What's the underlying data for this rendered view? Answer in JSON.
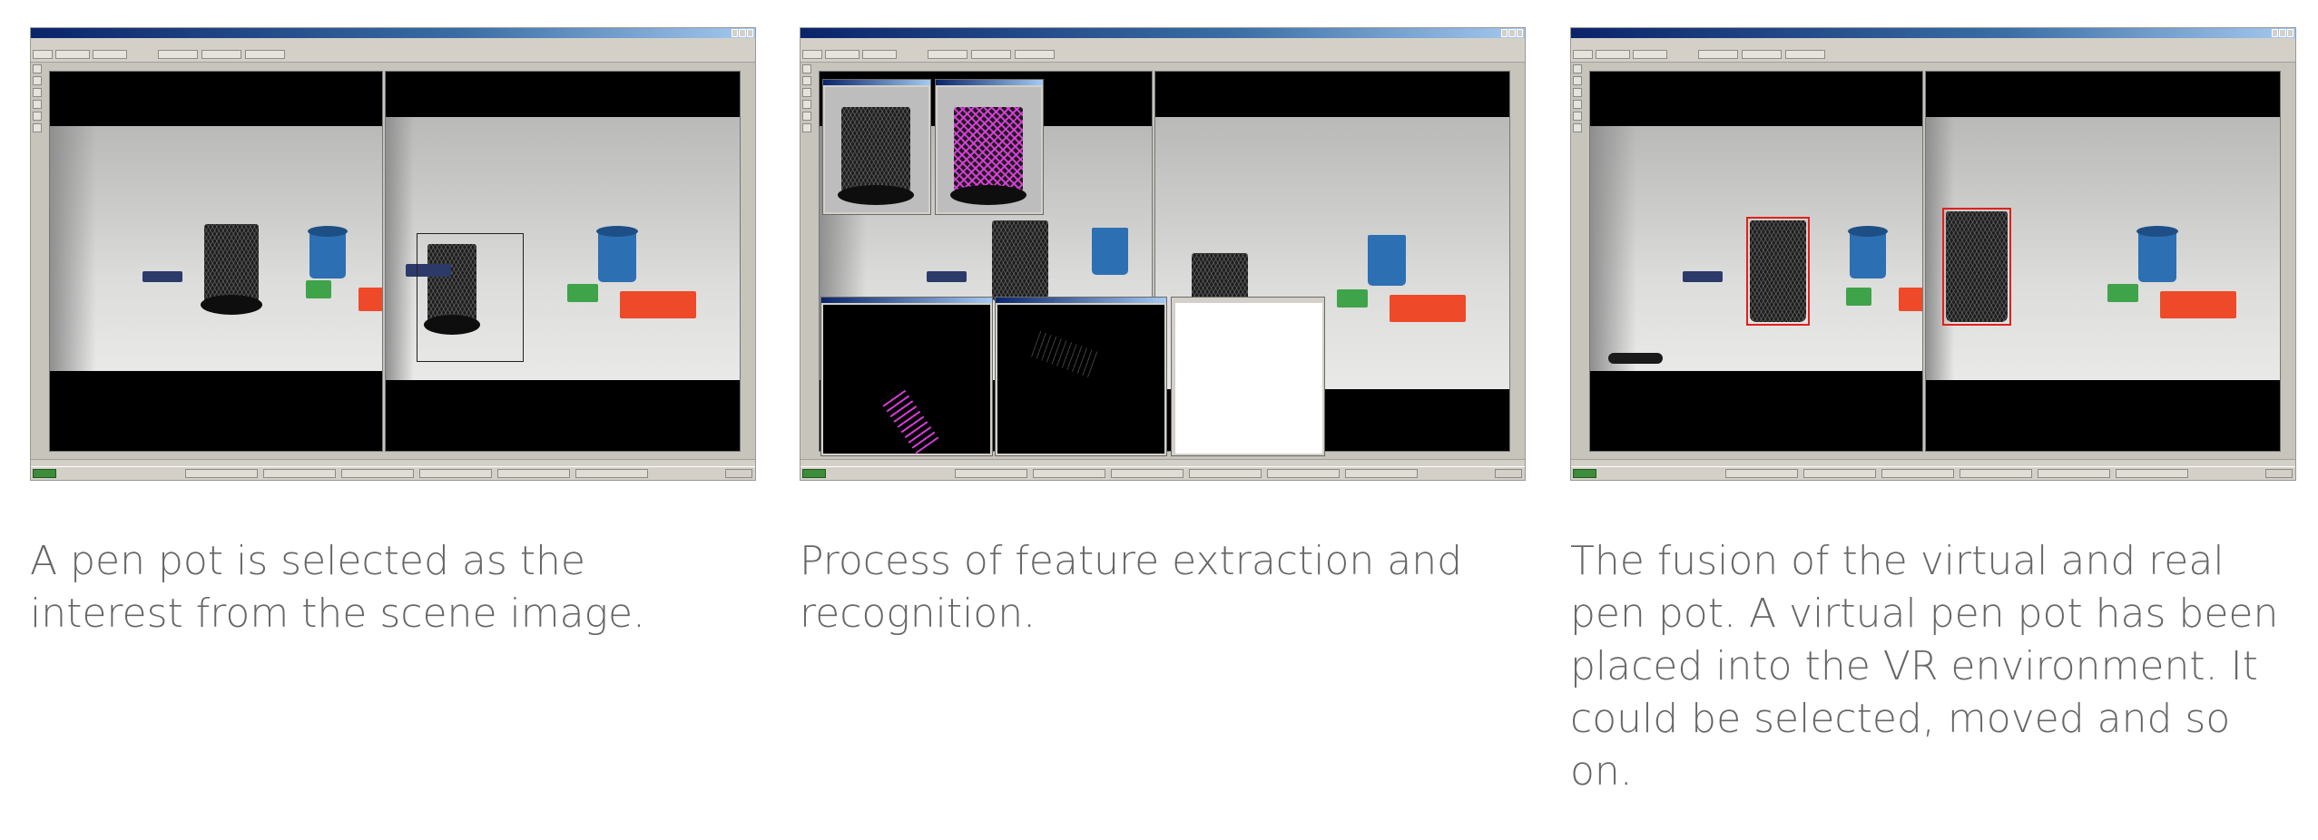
{
  "panels": [
    {
      "id": "selection",
      "caption": "A pen pot is selected as the interest from the scene image.",
      "screenshot": {
        "content": "window showing left and right camera views with pen pot, blue cup and lego blocks; pen pot outlined in the right view"
      }
    },
    {
      "id": "extraction",
      "caption": "Process of feature extraction and recognition.",
      "screenshot": {
        "content": "window with extracted pen pot thumbnails, magenta feature points, black feature windows and a text output dialog"
      }
    },
    {
      "id": "fusion",
      "caption": "The fusion of the virtual and real pen pot. A virtual pen pot has been placed into the VR environment. It could be selected, moved and so on.",
      "screenshot": {
        "content": "window showing both camera views with the pen pot highlighted by red bounding boxes"
      }
    }
  ],
  "colors": {
    "caption_text": "#666666",
    "title_bar": "#0a246a",
    "feature_points": "#e040e0",
    "highlight_box": "#e0201c"
  }
}
